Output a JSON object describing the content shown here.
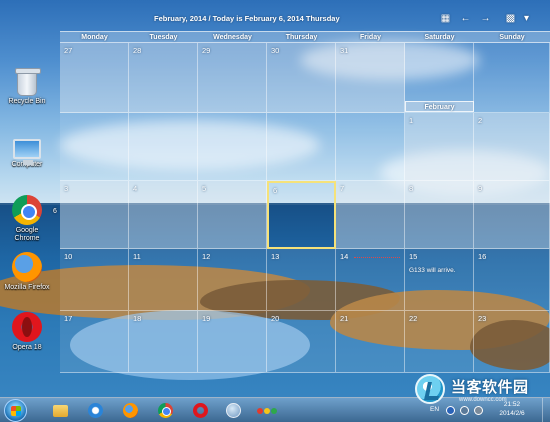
{
  "calendar": {
    "title": "February, 2014 / Today is February 6, 2014 Thursday",
    "weekdays": [
      "Monday",
      "Tuesday",
      "Wednesday",
      "Thursday",
      "Friday",
      "Saturday",
      "Sunday"
    ],
    "month_tab": "February",
    "weeks": [
      [
        {
          "d": "27",
          "s": "dim"
        },
        {
          "d": "28",
          "s": "dim"
        },
        {
          "d": "29",
          "s": "dim"
        },
        {
          "d": "30",
          "s": "dim"
        },
        {
          "d": "31",
          "s": "dim"
        },
        {
          "d": "",
          "s": "cur"
        },
        {
          "d": "",
          "s": "cur"
        }
      ],
      [
        {
          "d": "",
          "s": "cur"
        },
        {
          "d": "",
          "s": "cur"
        },
        {
          "d": "",
          "s": "cur"
        },
        {
          "d": "",
          "s": "cur"
        },
        {
          "d": "",
          "s": "cur"
        },
        {
          "d": "1",
          "s": "dim"
        },
        {
          "d": "2",
          "s": "dim"
        }
      ],
      [
        {
          "d": "3",
          "s": "dim"
        },
        {
          "d": "4",
          "s": "dim"
        },
        {
          "d": "5",
          "s": "dim"
        },
        {
          "d": "6",
          "s": "today"
        },
        {
          "d": "7",
          "s": "dim"
        },
        {
          "d": "8",
          "s": "dim"
        },
        {
          "d": "9",
          "s": "dim"
        }
      ],
      [
        {
          "d": "10",
          "s": "cur"
        },
        {
          "d": "11",
          "s": "cur"
        },
        {
          "d": "12",
          "s": "cur"
        },
        {
          "d": "13",
          "s": "cur"
        },
        {
          "d": "14",
          "s": "cur",
          "mark": true
        },
        {
          "d": "15",
          "s": "cur",
          "evt": "G133 will arrive."
        },
        {
          "d": "16",
          "s": "cur"
        }
      ],
      [
        {
          "d": "17",
          "s": "cur"
        },
        {
          "d": "18",
          "s": "cur"
        },
        {
          "d": "19",
          "s": "cur"
        },
        {
          "d": "20",
          "s": "cur"
        },
        {
          "d": "21",
          "s": "cur"
        },
        {
          "d": "22",
          "s": "cur"
        },
        {
          "d": "23",
          "s": "cur"
        }
      ]
    ],
    "week_side_labels": [
      "6"
    ]
  },
  "desktop_icons": [
    {
      "label": "Recycle Bin",
      "icon": "recycle-bin-icon"
    },
    {
      "label": "Computer",
      "icon": "computer-icon"
    },
    {
      "label": "Google Chrome",
      "icon": "chrome-icon"
    },
    {
      "label": "Mozilla Firefox",
      "icon": "firefox-icon"
    },
    {
      "label": "Opera 18",
      "icon": "opera-icon"
    }
  ],
  "taskbar": {
    "pinned": [
      "explorer-icon",
      "internet-explorer-icon",
      "firefox-icon",
      "chrome-icon",
      "opera-icon",
      "globe-icon",
      "colorful-dots-icon"
    ],
    "lang": "EN",
    "time": "21:52",
    "date": "2014/2/6"
  },
  "watermark": {
    "text": "当客软件园",
    "url": "www.downcc.com"
  },
  "colors": {
    "today_outline": "#f5e27a",
    "event_mark": "#e04848"
  }
}
